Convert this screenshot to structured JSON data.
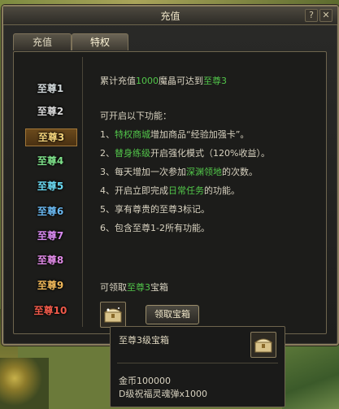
{
  "window": {
    "title": "充值",
    "help": "?",
    "close": "✕"
  },
  "tabs": [
    {
      "label": "充值"
    },
    {
      "label": "特权"
    }
  ],
  "vip_levels": [
    "至尊1",
    "至尊2",
    "至尊3",
    "至尊4",
    "至尊5",
    "至尊6",
    "至尊7",
    "至尊8",
    "至尊9",
    "至尊10"
  ],
  "selected_level": "至尊3",
  "summary": {
    "prefix": "累计充值",
    "amount": "1000",
    "middle": "魔晶可达到",
    "level": "至尊3"
  },
  "features": {
    "heading": "可开启以下功能：",
    "items": [
      {
        "pre": "1、",
        "hl": "特权商城",
        "post": "增加商品“经验加强卡”。"
      },
      {
        "pre": "2、",
        "hl": "替身练级",
        "post": "开启强化模式（120%收益）。"
      },
      {
        "pre": "3、",
        "mid": "每天增加一次参加",
        "hl": "深渊领地",
        "post": "的次数。"
      },
      {
        "pre": "4、",
        "mid": "开启立即完成",
        "hl": "日常任务",
        "post": "的功能。"
      },
      {
        "pre": "5、",
        "text": "享有尊贵的至尊3标记。"
      },
      {
        "pre": "6、",
        "text": "包含至尊1-2所有功能。"
      }
    ]
  },
  "reward": {
    "prefix": "可领取",
    "level": "至尊3",
    "suffix": "宝箱",
    "claim_button": "领取宝箱"
  },
  "tooltip": {
    "title": "至尊3级宝箱",
    "lines": [
      "金币100000",
      "D级祝福灵魂弹x1000"
    ]
  },
  "colors": {
    "highlight_green": "#52c64a",
    "amount_yellow": "#e6b84a",
    "frame_gold": "#8a7d5e"
  }
}
